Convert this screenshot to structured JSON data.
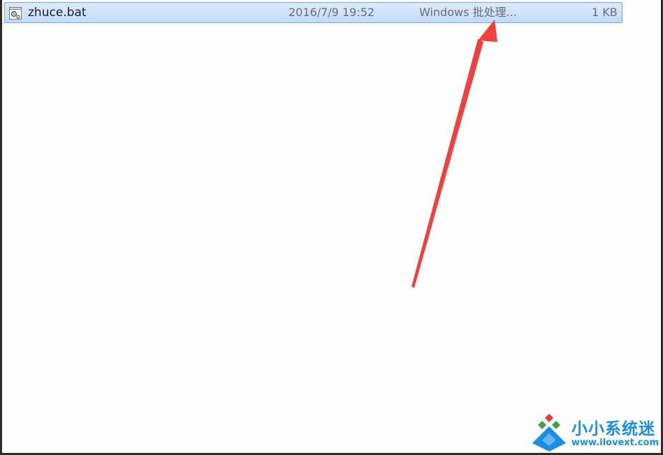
{
  "file_list": {
    "rows": [
      {
        "icon": "batch-file-icon",
        "name": "zhuce.bat",
        "date_modified": "2016/7/9 19:52",
        "type": "Windows 批处理...",
        "size": "1 KB",
        "selected": true
      }
    ]
  },
  "annotation": {
    "arrow_color": "#f04040",
    "points_to": "type"
  },
  "watermark": {
    "title": "小小系统迷",
    "url": "www.ilovext.com",
    "color": "#1a8ee0"
  }
}
